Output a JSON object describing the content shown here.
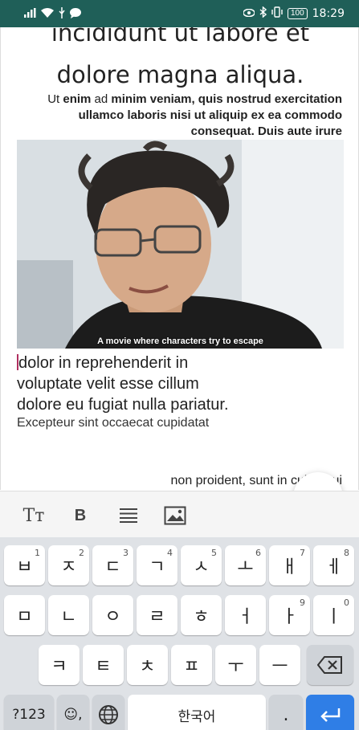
{
  "status_bar": {
    "time": "18:29",
    "battery": "100",
    "left_icons": [
      "signal-icon",
      "wifi-icon",
      "usb-icon",
      "message-icon"
    ],
    "right_icons": [
      "eye-icon",
      "bluetooth-icon",
      "vibrate-icon",
      "battery-icon"
    ]
  },
  "editor": {
    "heading_line1": "incididunt ut labore et",
    "heading_line2": "dolore magna aliqua.",
    "para_right_plain1": "Ut ",
    "para_right_bold1": "enim",
    "para_right_plain2": " ad ",
    "para_right_bold2": "minim veniam, quis nostrud exercitation ullamco laboris nisi ut aliquip ex ea commodo consequat. Duis aute irure",
    "image_caption": "A movie where characters try to escape",
    "para_left_line1": "dolor in reprehenderit in",
    "para_left_line2": "voluptate velit esse cillum",
    "para_left_line3": "dolore eu fugiat nulla pariatur.",
    "para_small": "Excepteur sint occaecat cupidatat",
    "para_bottom": "non proident, sunt in culpa qui"
  },
  "fab": {
    "icon": "code-toggle-icon",
    "label": "<>"
  },
  "toolbar": {
    "text_size_label": "Tт",
    "bold_label": "B",
    "align_icon": "align-justify-icon",
    "image_icon": "insert-image-icon"
  },
  "keyboard": {
    "row1": [
      {
        "char": "ㅂ",
        "hint": "1"
      },
      {
        "char": "ㅈ",
        "hint": "2"
      },
      {
        "char": "ㄷ",
        "hint": "3"
      },
      {
        "char": "ㄱ",
        "hint": "4"
      },
      {
        "char": "ㅅ",
        "hint": "5"
      },
      {
        "char": "ㅗ",
        "hint": "6"
      },
      {
        "char": "ㅐ",
        "hint": "7"
      },
      {
        "char": "ㅔ",
        "hint": "8"
      }
    ],
    "row2": [
      {
        "char": "ㅁ",
        "hint": ""
      },
      {
        "char": "ㄴ",
        "hint": ""
      },
      {
        "char": "ㅇ",
        "hint": ""
      },
      {
        "char": "ㄹ",
        "hint": ""
      },
      {
        "char": "ㅎ",
        "hint": ""
      },
      {
        "char": "ㅓ",
        "hint": ""
      },
      {
        "char": "ㅏ",
        "hint": "9"
      },
      {
        "char": "ㅣ",
        "hint": "0"
      }
    ],
    "row3": [
      {
        "char": "ㅋ"
      },
      {
        "char": "ㅌ"
      },
      {
        "char": "ㅊ"
      },
      {
        "char": "ㅍ"
      },
      {
        "char": "ㅜ"
      },
      {
        "char": "ㅡ"
      }
    ],
    "backspace_icon": "backspace-icon",
    "symbols_label": "?123",
    "emoji_label": "☺,",
    "globe_icon": "globe-icon",
    "space_label": "한국어",
    "period_label": ".",
    "enter_icon": "enter-icon"
  }
}
